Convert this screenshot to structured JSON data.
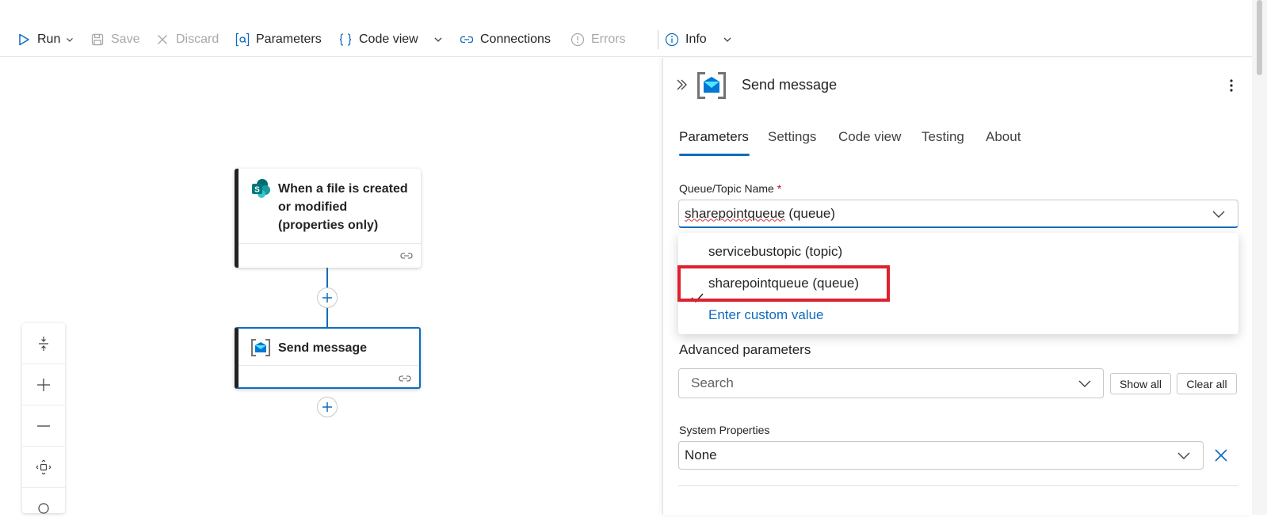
{
  "toolbar": {
    "run": "Run",
    "save": "Save",
    "discard": "Discard",
    "parameters": "Parameters",
    "code_view": "Code view",
    "connections": "Connections",
    "errors": "Errors",
    "info": "Info"
  },
  "workflow": {
    "trigger_title_line1": "When a file is created",
    "trigger_title_line2": "or modified",
    "trigger_title_line3": "(properties only)",
    "action_title": "Send message"
  },
  "panel": {
    "title": "Send message",
    "tabs": [
      "Parameters",
      "Settings",
      "Code view",
      "Testing",
      "About"
    ],
    "active_tab": "Parameters",
    "queue_label": "Queue/Topic Name",
    "queue_required": "*",
    "queue_value": "sharepointqueue",
    "queue_value_suffix": " (queue)",
    "options": [
      "servicebustopic (topic)",
      "sharepointqueue (queue)"
    ],
    "selected_option": "sharepointqueue (queue)",
    "custom_value_link": "Enter custom value",
    "advanced_label": "Advanced parameters",
    "search_placeholder": "Search",
    "show_all": "Show all",
    "clear_all": "Clear all",
    "system_properties_label": "System Properties",
    "system_properties_value": "None"
  },
  "colors": {
    "accent": "#0f6cbd",
    "highlight": "#e0202e",
    "disabled_text": "#a8a8a8"
  },
  "icons": {
    "run": "play-icon",
    "save": "save-icon",
    "discard": "close-icon",
    "parameters": "parameters-icon",
    "code_view": "braces-icon",
    "connections": "link-icon",
    "errors": "info-circle-icon",
    "info": "info-circle-icon"
  }
}
